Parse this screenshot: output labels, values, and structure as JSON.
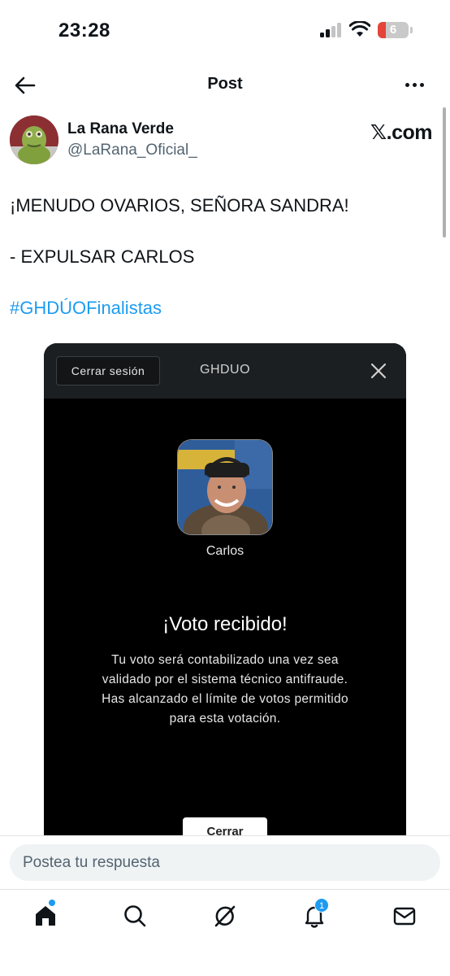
{
  "status_bar": {
    "time": "23:28",
    "battery": "6"
  },
  "header": {
    "title": "Post"
  },
  "author": {
    "name": "La Rana Verde",
    "handle": "@LaRana_Oficial_",
    "source": "𝕏.com"
  },
  "tweet": {
    "line1": "¡MENUDO OVARIOS, SEÑORA SANDRA!",
    "line2": "- EXPULSAR CARLOS",
    "hashtag": "#GHDÚOFinalistas"
  },
  "media": {
    "logout_label": "Cerrar sesión",
    "brand": "GHDUO",
    "candidate_name": "Carlos",
    "vote_title": "¡Voto recibido!",
    "message_lines": [
      "Tu voto será contabilizado una vez sea",
      "validado por el sistema técnico antifraude.",
      "Has alcanzado el límite de votos permitido",
      "para esta votación."
    ],
    "close_label": "Cerrar"
  },
  "reply": {
    "placeholder": "Postea tu respuesta"
  },
  "nav": {
    "notifications_count": "1"
  },
  "colors": {
    "accent": "#1d9bf0",
    "text": "#0f1419",
    "muted": "#536471"
  }
}
